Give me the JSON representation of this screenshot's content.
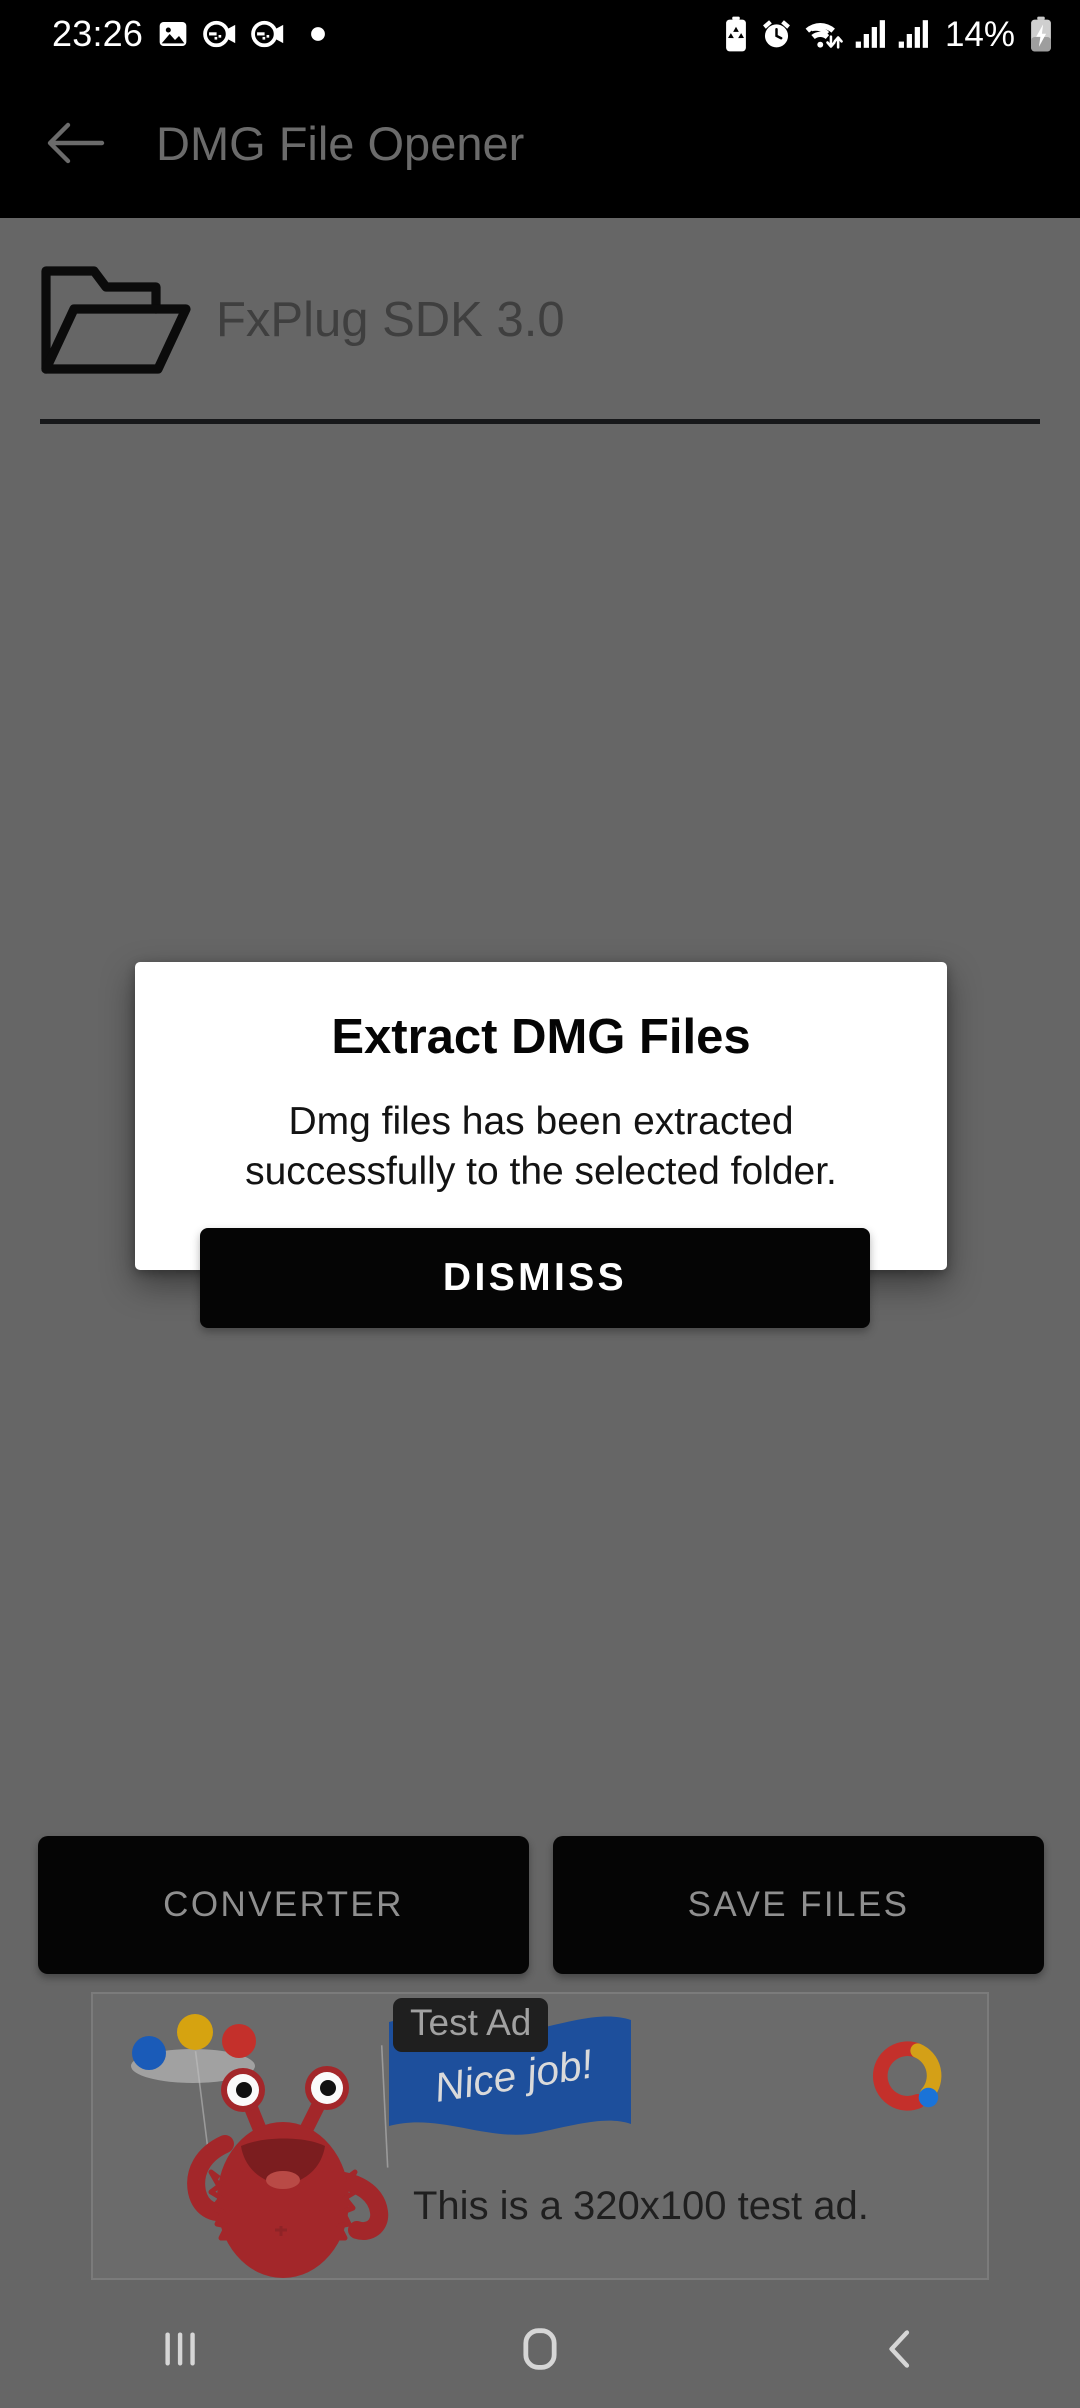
{
  "status_bar": {
    "clock": "23:26",
    "battery_percent": "14%",
    "left_icons": [
      "image-icon",
      "screen-recorder-icon",
      "screen-recorder-icon",
      "dot-indicator-icon"
    ],
    "right_icons": [
      "battery-saver-icon",
      "alarm-clock-icon",
      "wifi-icon",
      "signal-bars-icon",
      "signal-bars-icon-2",
      "battery-charging-icon"
    ]
  },
  "app_bar": {
    "title": "DMG File Opener",
    "back_icon": "arrow-left-icon"
  },
  "content": {
    "folder": {
      "icon": "open-folder-icon",
      "label": "FxPlug SDK 3.0"
    }
  },
  "bottom_actions": {
    "converter_label": "CONVERTER",
    "save_files_label": "SAVE FILES"
  },
  "ad": {
    "badge_label": "Test Ad",
    "flag_text": "Nice job!",
    "caption": "This is a 320x100 test ad.",
    "logo": "admob-logo",
    "size": "320x100"
  },
  "dialog": {
    "title": "Extract DMG Files",
    "message": "Dmg files has been extracted successfully to the selected folder.",
    "dismiss_label": "DISMISS"
  },
  "nav_bar": {
    "recents": "recents-icon",
    "home": "home-icon",
    "back": "back-icon"
  },
  "colors": {
    "scrim": "#666666",
    "app_bar_bg": "#000000",
    "button_bg": "#050505",
    "dialog_bg": "#ffffff",
    "ad_flag_blue": "#1d4f9c",
    "ad_monster_red": "#a3272a",
    "admob_red": "#c4302b",
    "admob_yellow": "#d4a017",
    "admob_blue": "#1a73d8"
  }
}
